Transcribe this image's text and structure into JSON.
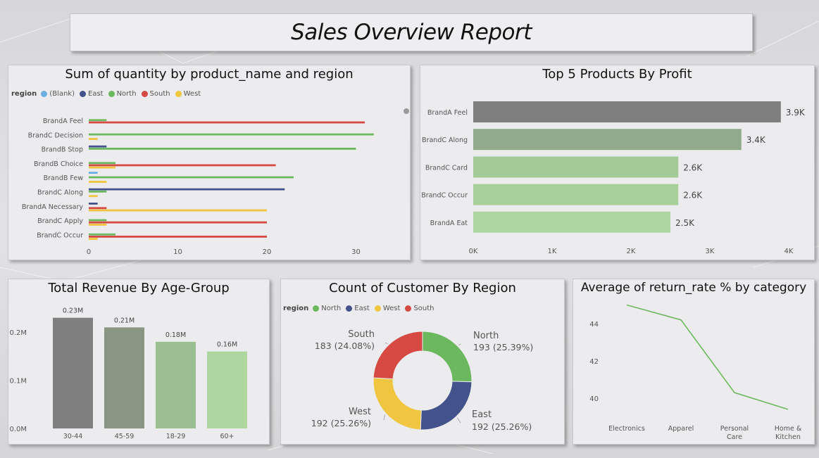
{
  "page": {
    "title": "Sales Overview Report"
  },
  "colors": {
    "blank": "#6aaee2",
    "east": "#44528c",
    "north": "#6cb85e",
    "south": "#d64a43",
    "west": "#f0c540",
    "profit": [
      "#7f7f7f",
      "#92aa8c",
      "#a4cb97",
      "#a8d09a",
      "#add6a0"
    ],
    "age": [
      "#7f7f7f",
      "#8a9684",
      "#9cbf92",
      "#add6a0"
    ],
    "line": "#6cb85e"
  },
  "chart_data": [
    {
      "type": "bar",
      "orientation": "horizontal",
      "title": "Sum of quantity by product_name and region",
      "legend_title": "region",
      "legend_placement": "top-left",
      "categories": [
        "BrandA Feel",
        "BrandC Decision",
        "BrandB Stop",
        "BrandB Choice",
        "BrandB Few",
        "BrandC Along",
        "BrandA Necessary",
        "BrandC Apply",
        "BrandC Occur"
      ],
      "series": [
        {
          "name": "(Blank)",
          "key": "blank",
          "values": [
            0,
            0,
            0,
            0,
            1,
            0,
            0,
            0,
            0
          ]
        },
        {
          "name": "East",
          "key": "east",
          "values": [
            0,
            0,
            2,
            0,
            0,
            22,
            1,
            0,
            0
          ]
        },
        {
          "name": "North",
          "key": "north",
          "values": [
            2,
            32,
            30,
            3,
            23,
            2,
            0,
            2,
            3
          ]
        },
        {
          "name": "South",
          "key": "south",
          "values": [
            31,
            0,
            0,
            21,
            0,
            0,
            2,
            20,
            20
          ]
        },
        {
          "name": "West",
          "key": "west",
          "values": [
            0,
            1,
            0,
            3,
            2,
            1,
            20,
            2,
            1
          ]
        }
      ],
      "xticks": [
        "0",
        "10",
        "20",
        "30"
      ],
      "xlim": [
        0,
        33
      ]
    },
    {
      "type": "bar",
      "orientation": "horizontal",
      "title": "Top 5 Products By Profit",
      "categories": [
        "BrandA Feel",
        "BrandC Along",
        "BrandC Card",
        "BrandC Occur",
        "BrandA Eat"
      ],
      "values": [
        3900,
        3400,
        2600,
        2600,
        2500
      ],
      "data_labels": [
        "3.9K",
        "3.4K",
        "2.6K",
        "2.6K",
        "2.5K"
      ],
      "xticks": [
        "0K",
        "1K",
        "2K",
        "3K",
        "4K"
      ],
      "xlim": [
        0,
        4000
      ]
    },
    {
      "type": "bar",
      "title": "Total Revenue By Age-Group",
      "categories": [
        "30-44",
        "45-59",
        "18-29",
        "60+"
      ],
      "values": [
        0.23,
        0.21,
        0.18,
        0.16
      ],
      "data_labels": [
        "0.23M",
        "0.21M",
        "0.18M",
        "0.16M"
      ],
      "yticks": [
        "0.0M",
        "0.1M",
        "0.2M"
      ],
      "ylim": [
        0,
        0.25
      ]
    },
    {
      "type": "pie",
      "donut": true,
      "title": "Count of Customer By Region",
      "legend_title": "region",
      "legend_placement": "top-left",
      "slices": [
        {
          "name": "North",
          "key": "north",
          "value": 193,
          "label": "193 (25.39%)"
        },
        {
          "name": "East",
          "key": "east",
          "value": 192,
          "label": "192 (25.26%)"
        },
        {
          "name": "West",
          "key": "west",
          "value": 192,
          "label": "192 (25.26%)"
        },
        {
          "name": "South",
          "key": "south",
          "value": 183,
          "label": "183 (24.08%)"
        }
      ]
    },
    {
      "type": "line",
      "title": "Average of return_rate % by category",
      "categories": [
        "Electronics",
        "Apparel",
        "Personal Care",
        "Home & Kitchen"
      ],
      "category_lines": [
        [
          "Electronics"
        ],
        [
          "Apparel"
        ],
        [
          "Personal",
          "Care"
        ],
        [
          "Home &",
          "Kitchen"
        ]
      ],
      "values": [
        45.0,
        44.2,
        40.3,
        39.4
      ],
      "yticks": [
        "40",
        "42",
        "44"
      ],
      "ylim": [
        38.6,
        45.5
      ]
    }
  ]
}
